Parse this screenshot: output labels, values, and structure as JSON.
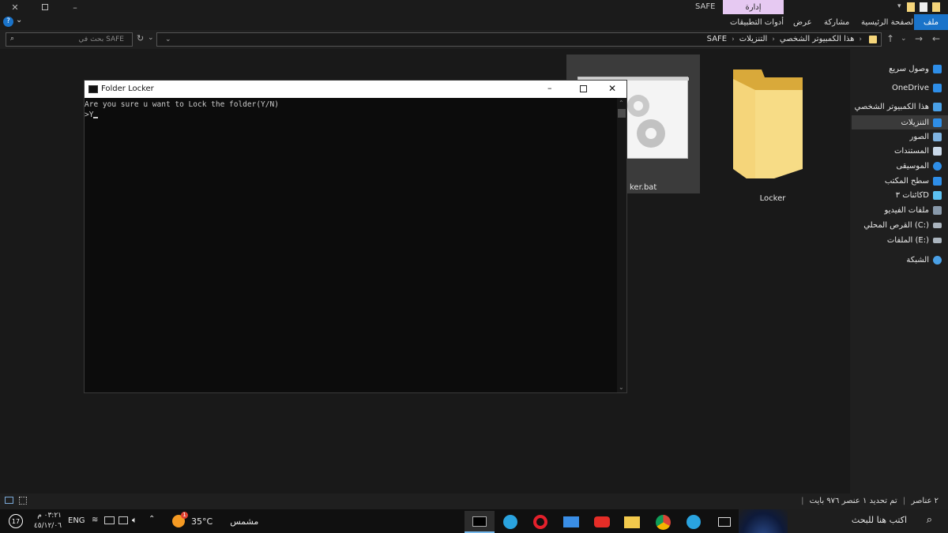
{
  "titlebar": {
    "window_title": "SAFE",
    "manage_tab": "إدارة"
  },
  "ribbon": {
    "tabs": [
      "ملف",
      "الصفحة الرئيسية",
      "مشاركة",
      "عرض",
      "أدوات التطبيقات"
    ]
  },
  "address": {
    "search_placeholder": "بحث في SAFE",
    "breadcrumb": [
      "هذا الكمبيوتر الشخصي",
      "التنزيلات",
      "SAFE"
    ]
  },
  "files": [
    {
      "name": "Locker",
      "type": "folder"
    },
    {
      "name": "Locker.bat",
      "type": "batch-file",
      "visible_label": "ker.bat"
    }
  ],
  "navpane": {
    "items": [
      {
        "label": "وصول سريع",
        "icon": "star-icon"
      },
      {
        "label": "OneDrive",
        "icon": "cloud-icon"
      },
      {
        "label": "هذا الكمبيوتر الشخصي",
        "icon": "computer-icon"
      },
      {
        "label": "التنزيلات",
        "icon": "download-icon",
        "selected": true
      },
      {
        "label": "الصور",
        "icon": "pictures-icon"
      },
      {
        "label": "المستندات",
        "icon": "documents-icon"
      },
      {
        "label": "الموسيقى",
        "icon": "music-icon"
      },
      {
        "label": "سطح المكتب",
        "icon": "desktop-icon"
      },
      {
        "label": "كائنات ٣D",
        "icon": "objects-3d-icon"
      },
      {
        "label": "ملفات الفيديو",
        "icon": "video-icon"
      },
      {
        "label": "القرص المحلي (C:)",
        "icon": "drive-icon"
      },
      {
        "label": "الملفات (E:)",
        "icon": "drive-icon"
      },
      {
        "label": "الشبكة",
        "icon": "network-icon"
      }
    ]
  },
  "cmd": {
    "title": "Folder Locker",
    "line1": "Are you sure u want to Lock the folder(Y/N)",
    "line2": ">Y"
  },
  "statusbar": {
    "items_count": "٢ عناصر",
    "selection": "تم تحديد ١ عنصر ٩٧٦ بايت"
  },
  "taskbar": {
    "search_placeholder": "اكتب هنا للبحث",
    "weather_temp": "35°C",
    "weather_desc": "مشمس",
    "weather_badge": "1",
    "language": "ENG",
    "time": "٠٣:٢١ م",
    "date": "٤٥/١٢/٠٦",
    "notifications": "17"
  },
  "colors": {
    "accent": "#1a73c9",
    "manage_tab_bg": "#e6c9f2",
    "folder_yellow": "#f5d57a",
    "cmd_bg": "#0c0c0c"
  }
}
